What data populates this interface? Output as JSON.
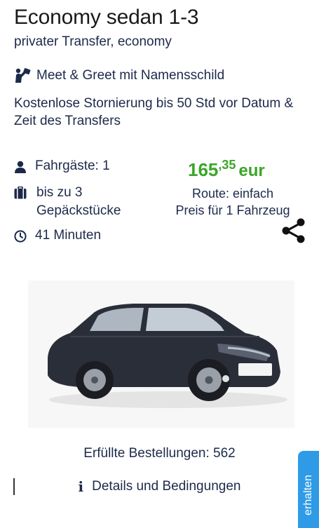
{
  "offer": {
    "title": "Economy sedan 1-3",
    "subtitle": "privater Transfer, economy",
    "meet_greet": "Meet & Greet mit Namensschild",
    "cancellation": "Kostenlose Stornierung bis 50 Std vor Datum & Zeit des Transfers",
    "passengers": "Fahrgäste: 1",
    "luggage": "bis zu 3 Gepäckstücke",
    "duration": "41 Minuten",
    "price_main": "165",
    "price_cents": ",35",
    "price_currency": "eur",
    "route": "Route: einfach",
    "price_note": "Preis für 1 Fahrzeug",
    "orders": "Erfüllte Bestellungen: 562",
    "details": "Details und Bedingungen",
    "side_tab": "erhalten"
  },
  "icons": {
    "meet": "person-sign-icon",
    "passengers": "user-icon",
    "luggage": "suitcase-icon",
    "duration": "clock-icon",
    "share": "share-icon",
    "details": "info-icon"
  },
  "colors": {
    "text": "#1c2a4a",
    "price": "#3aa628",
    "tab": "#2f9be6"
  }
}
